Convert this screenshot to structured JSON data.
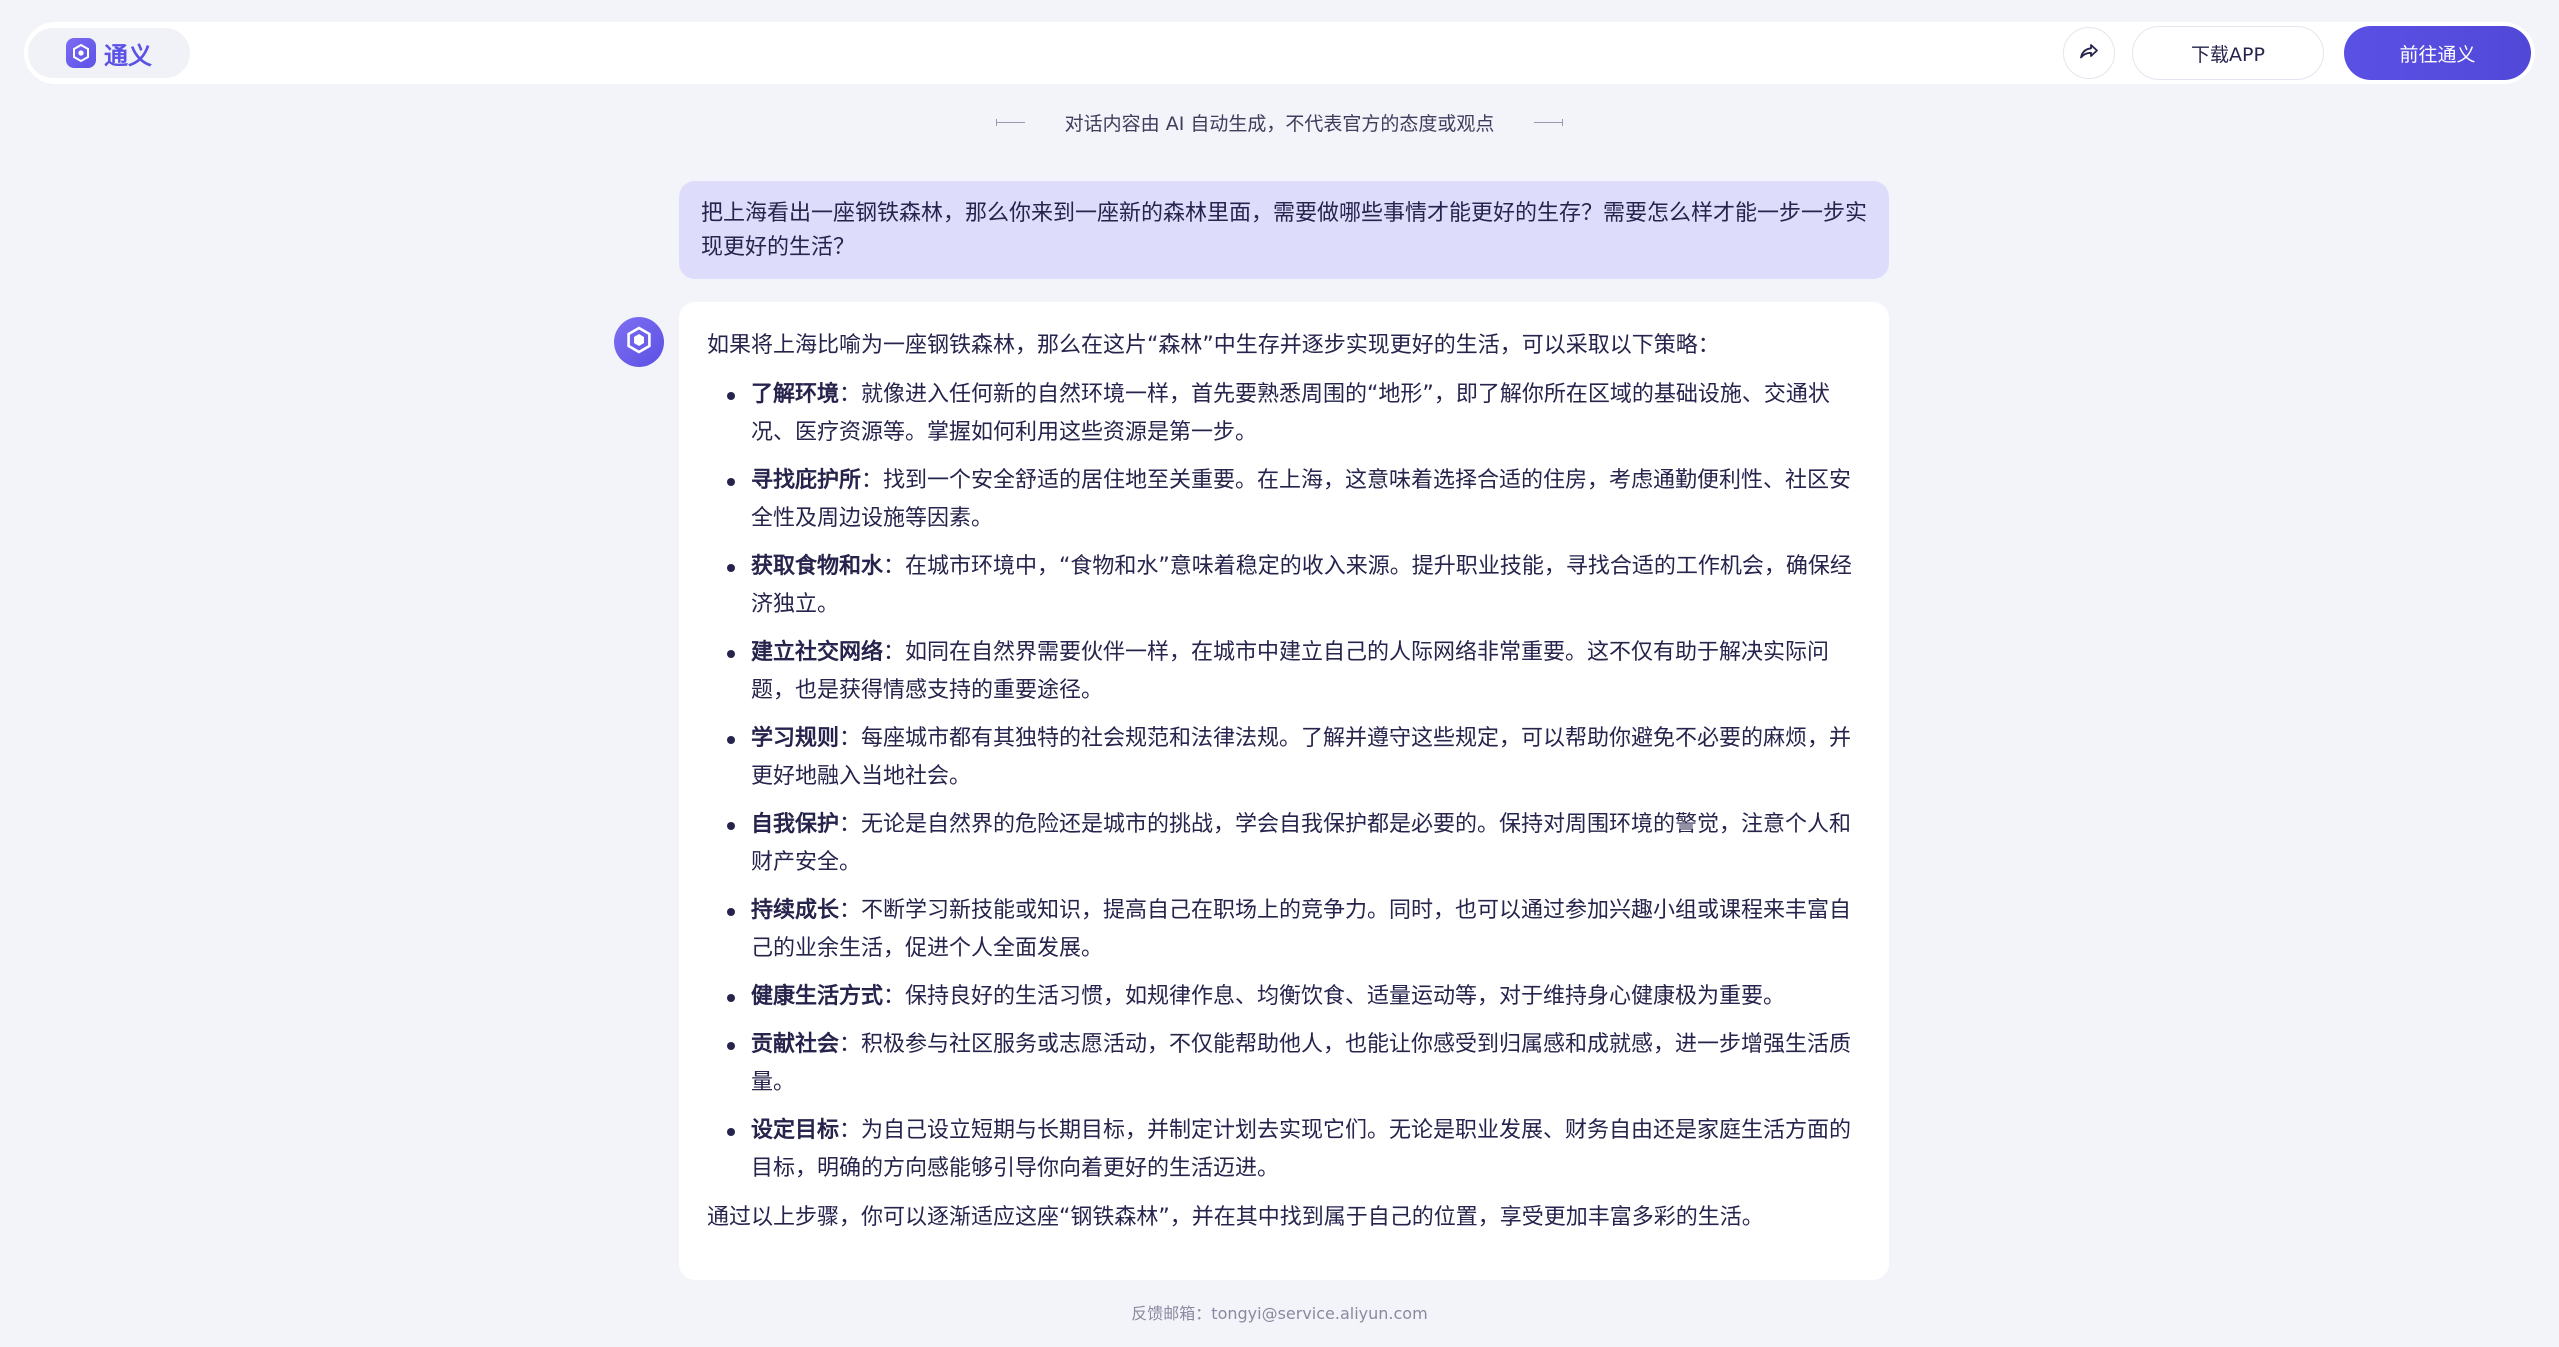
{
  "header": {
    "brand": "通义",
    "download_label": "下载APP",
    "goto_label": "前往通义"
  },
  "notice": {
    "text": "对话内容由 AI 自动生成，不代表官方的态度或观点"
  },
  "user_message": {
    "text": "把上海看出一座钢铁森林，那么你来到一座新的森林里面，需要做哪些事情才能更好的生存？需要怎么样才能一步一步实现更好的生活？"
  },
  "answer": {
    "intro": "如果将上海比喻为一座钢铁森林，那么在这片“森林”中生存并逐步实现更好的生活，可以采取以下策略：",
    "items": [
      {
        "term": "了解环境",
        "desc": "：就像进入任何新的自然环境一样，首先要熟悉周围的“地形”，即了解你所在区域的基础设施、交通状况、医疗资源等。掌握如何利用这些资源是第一步。"
      },
      {
        "term": "寻找庇护所",
        "desc": "：找到一个安全舒适的居住地至关重要。在上海，这意味着选择合适的住房，考虑通勤便利性、社区安全性及周边设施等因素。"
      },
      {
        "term": "获取食物和水",
        "desc": "：在城市环境中，“食物和水”意味着稳定的收入来源。提升职业技能，寻找合适的工作机会，确保经济独立。"
      },
      {
        "term": "建立社交网络",
        "desc": "：如同在自然界需要伙伴一样，在城市中建立自己的人际网络非常重要。这不仅有助于解决实际问题，也是获得情感支持的重要途径。"
      },
      {
        "term": "学习规则",
        "desc": "：每座城市都有其独特的社会规范和法律法规。了解并遵守这些规定，可以帮助你避免不必要的麻烦，并更好地融入当地社会。"
      },
      {
        "term": "自我保护",
        "desc": "：无论是自然界的危险还是城市的挑战，学会自我保护都是必要的。保持对周围环境的警觉，注意个人和财产安全。"
      },
      {
        "term": "持续成长",
        "desc": "：不断学习新技能或知识，提高自己在职场上的竞争力。同时，也可以通过参加兴趣小组或课程来丰富自己的业余生活，促进个人全面发展。"
      },
      {
        "term": "健康生活方式",
        "desc": "：保持良好的生活习惯，如规律作息、均衡饮食、适量运动等，对于维持身心健康极为重要。"
      },
      {
        "term": "贡献社会",
        "desc": "：积极参与社区服务或志愿活动，不仅能帮助他人，也能让你感受到归属感和成就感，进一步增强生活质量。"
      },
      {
        "term": "设定目标",
        "desc": "：为自己设立短期与长期目标，并制定计划去实现它们。无论是职业发展、财务自由还是家庭生活方面的目标，明确的方向感能够引导你向着更好的生活迈进。"
      }
    ],
    "outro": "通过以上步骤，你可以逐渐适应这座“钢铁森林”，并在其中找到属于自己的位置，享受更加丰富多彩的生活。"
  },
  "footer": {
    "text": "反馈邮箱：tongyi@service.aliyun.com"
  },
  "icons": {
    "brand": "tongyi-logo-icon",
    "share": "share-icon",
    "assistant": "assistant-avatar-icon"
  },
  "colors": {
    "accent": "#5b50e4",
    "user_bubble": "#dedcfb",
    "background": "#f3f4f9"
  }
}
